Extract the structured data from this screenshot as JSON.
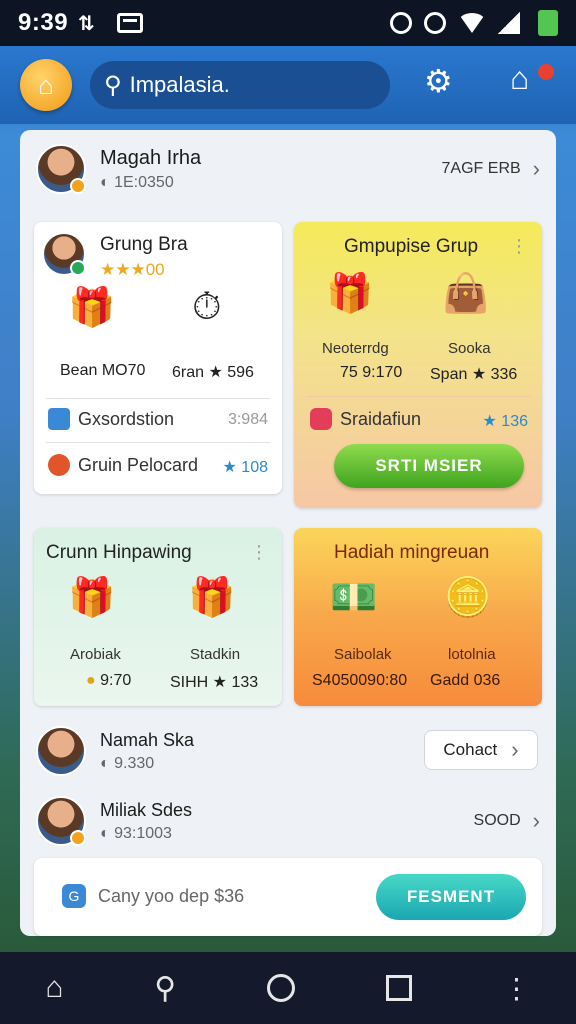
{
  "status_bar": {
    "time": "9:39",
    "left_icon": "data-saver-icon",
    "right_icons": [
      "alarm-icon",
      "settings-icon",
      "wifi-icon",
      "signal-icon",
      "battery-icon"
    ]
  },
  "app_bar": {
    "search_text": "Impalasia.",
    "icons": [
      "home-icon",
      "search-icon",
      "gear-icon",
      "house-icon"
    ]
  },
  "profile_top": {
    "name": "Magah Irha",
    "sub": "1E:0350",
    "right_label": "7AGF ERB"
  },
  "card_group": {
    "title": "Grung Bra",
    "stars": "★★★00",
    "item1_label": "Bean MO70",
    "item2_label": "6ran ★ 596",
    "row1_text": "Gxsordstion",
    "row1_val": "3:984",
    "row2_text": "Gruin Pelocard",
    "row2_val": "★ 108"
  },
  "card_yellow": {
    "title": "Gmpupise Grup",
    "item1_label": "Neoterrdg",
    "item1_value": "75 9:170",
    "item2_label": "Sooka",
    "item2_value": "Span ★ 336",
    "row_text": "Sraidafiun",
    "row_val": "★ 136",
    "button": "SRTI MSIER"
  },
  "card_mint": {
    "title": "Crunn Hinpawing",
    "item1_label": "Arobiak",
    "item1_value": "9:70",
    "item2_label": "Stadkin",
    "item2_value": "SIHH ★ 133"
  },
  "card_orange": {
    "title": "Hadiah mingreuan",
    "item1_label": "Saibolak",
    "item1_value": "S4050090:80",
    "item2_label": "lotolnia",
    "item2_value": "Gadd 036"
  },
  "profile_2": {
    "name": "Namah Ska",
    "sub": "9.330",
    "button": "Cohact"
  },
  "profile_3": {
    "name": "Miliak Sdes",
    "sub": "93:1003",
    "right_label": "SOOD"
  },
  "bottom_card": {
    "text": "Cany yoo dep $36",
    "button": "FESMENT"
  },
  "nav_bar": {
    "icons": [
      "home-icon",
      "search-icon",
      "circle-icon",
      "square-icon",
      "more-icon"
    ]
  },
  "colors": {
    "app_bar": "#1f63b3",
    "accent_orange": "#f29a15",
    "green_button": "#3fa41e",
    "teal_button": "#1aa7b2"
  }
}
